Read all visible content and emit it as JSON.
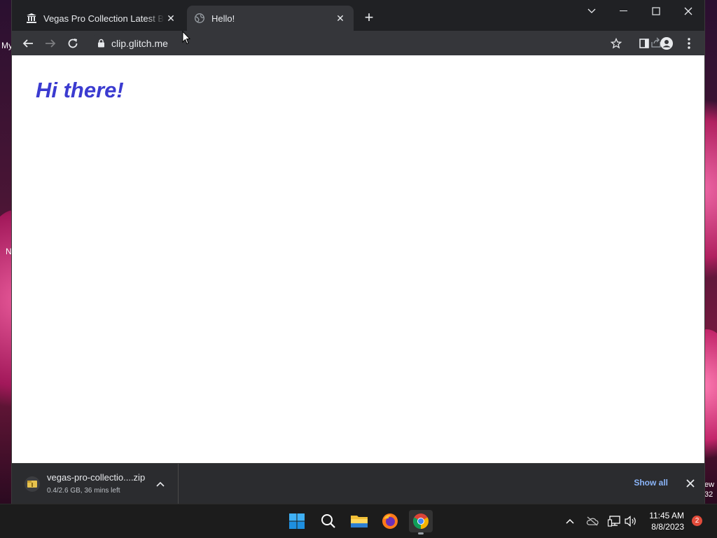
{
  "desktop": {
    "edge_text_top": "My",
    "edge_text_mid": "N",
    "edge_text_right_1": "ew",
    "edge_text_right_2": "32"
  },
  "browser": {
    "tabs": [
      {
        "title": "Vegas Pro Collection Latest Build",
        "active": false,
        "favicon": "museum-icon"
      },
      {
        "title": "Hello!",
        "active": true,
        "favicon": "globe-icon"
      }
    ],
    "address_bar": {
      "url": "clip.glitch.me",
      "security_icon": "lock-icon"
    },
    "page": {
      "heading": "Hi there!",
      "heading_color": "#3b3bd0"
    }
  },
  "download_bar": {
    "file_name": "vegas-pro-collectio....zip",
    "status": "0.4/2.6 GB, 36 mins left",
    "show_all_label": "Show all"
  },
  "taskbar": {
    "time": "11:45 AM",
    "date": "8/8/2023",
    "notification_count": "2",
    "apps": [
      "windows-start-icon",
      "search-icon",
      "file-explorer-icon",
      "firefox-icon",
      "chrome-icon"
    ]
  }
}
